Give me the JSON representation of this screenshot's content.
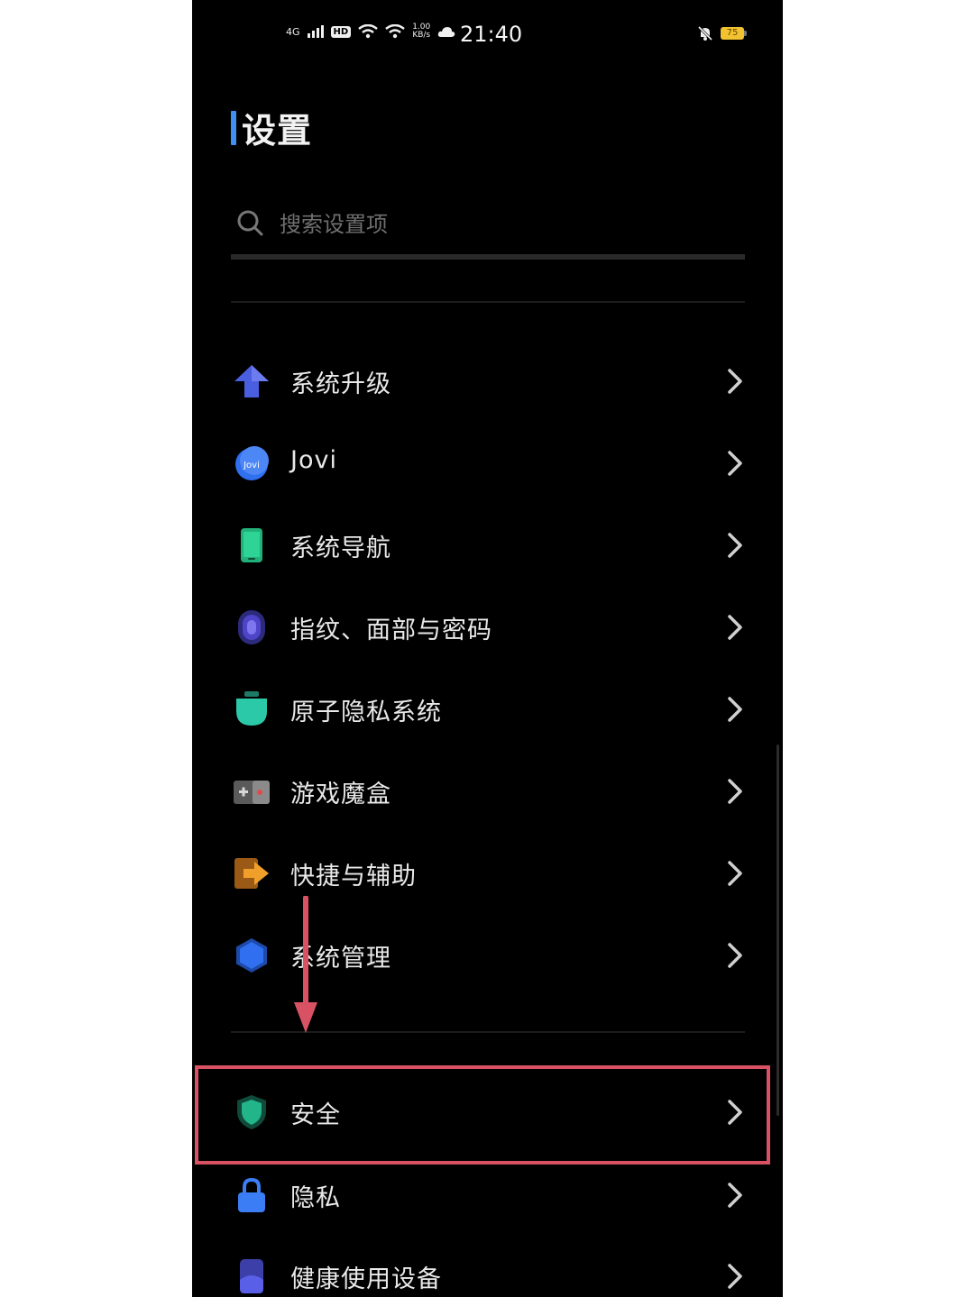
{
  "status_bar": {
    "network": "4G",
    "hd": "HD",
    "speed_value": "1.00",
    "speed_unit": "KB/s",
    "time": "21:40",
    "battery": "75"
  },
  "page": {
    "title": "设置"
  },
  "search": {
    "placeholder": "搜索设置项"
  },
  "group1": [
    {
      "label": "系统升级",
      "icon": "upgrade-arrow-icon",
      "color": "#4a5fe0"
    },
    {
      "label": "Jovi",
      "icon": "jovi-icon",
      "color": "#2f6ff0"
    },
    {
      "label": "系统导航",
      "icon": "phone-icon",
      "color": "#22b07a"
    },
    {
      "label": "指纹、面部与密码",
      "icon": "fingerprint-icon",
      "color": "#4d44c8"
    },
    {
      "label": "原子隐私系统",
      "icon": "atom-privacy-icon",
      "color": "#2cc9a8"
    },
    {
      "label": "游戏魔盒",
      "icon": "gamepad-icon",
      "color": "#8a8a8a"
    },
    {
      "label": "快捷与辅助",
      "icon": "shortcut-arrow-icon",
      "color": "#f0a02a"
    },
    {
      "label": "系统管理",
      "icon": "hexagon-icon",
      "color": "#2f6ff0"
    }
  ],
  "group2": [
    {
      "label": "安全",
      "icon": "shield-icon",
      "color": "#22b58a"
    },
    {
      "label": "隐私",
      "icon": "lock-icon",
      "color": "#3b7df5"
    },
    {
      "label": "健康使用设备",
      "icon": "hourglass-icon",
      "color": "#5a5fe8"
    }
  ],
  "annotation": {
    "highlight_color": "#d85264"
  }
}
